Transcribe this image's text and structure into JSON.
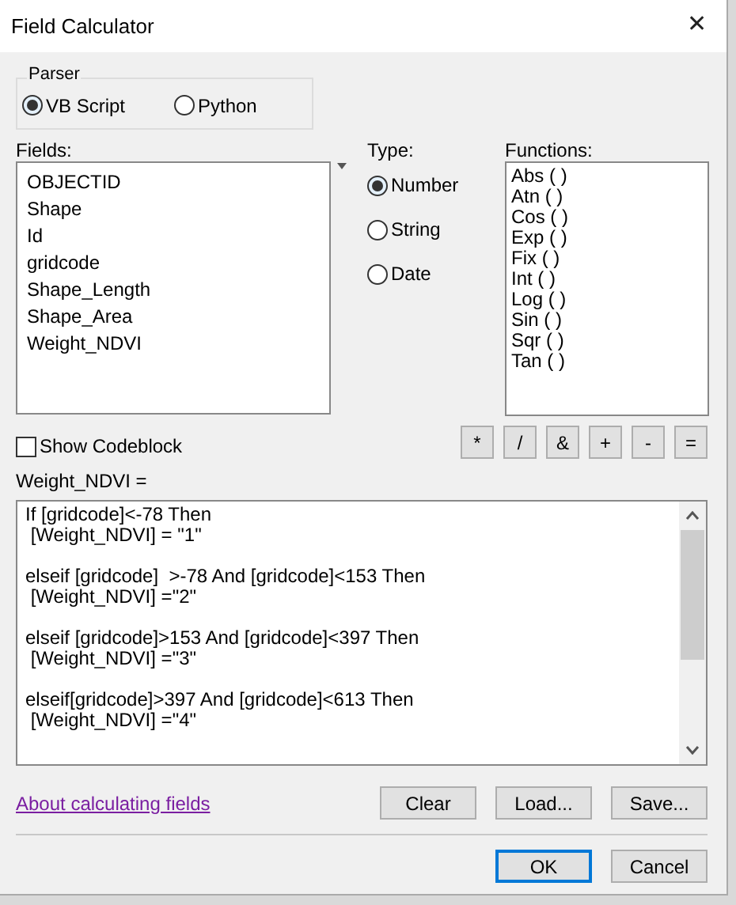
{
  "window": {
    "title": "Field Calculator",
    "close": "✕"
  },
  "parser": {
    "label": "Parser",
    "options": [
      {
        "label": "VB Script",
        "selected": true
      },
      {
        "label": "Python",
        "selected": false
      }
    ]
  },
  "fields": {
    "label": "Fields:",
    "items": [
      "OBJECTID",
      "Shape",
      "Id",
      "gridcode",
      "Shape_Length",
      "Shape_Area",
      "Weight_NDVI"
    ]
  },
  "type": {
    "label": "Type:",
    "options": [
      {
        "label": "Number",
        "selected": true
      },
      {
        "label": "String",
        "selected": false
      },
      {
        "label": "Date",
        "selected": false
      }
    ]
  },
  "functions": {
    "label": "Functions:",
    "items": [
      "Abs ( )",
      "Atn ( )",
      "Cos ( )",
      "Exp ( )",
      "Fix ( )",
      "Int ( )",
      "Log ( )",
      "Sin ( )",
      "Sqr ( )",
      "Tan ( )"
    ]
  },
  "show_codeblock": {
    "label": "Show Codeblock",
    "checked": false
  },
  "operators": [
    "*",
    "/",
    "&",
    "+",
    "-",
    "="
  ],
  "expression": {
    "label": "Weight_NDVI =",
    "blocks": [
      [
        "If [gridcode]<-78 Then",
        " [Weight_NDVI] = \"1\""
      ],
      [
        "elseif [gridcode]  >-78 And [gridcode]<153 Then",
        " [Weight_NDVI] =\"2\""
      ],
      [
        "elseif [gridcode]>153 And [gridcode]<397 Then",
        " [Weight_NDVI] =\"3\""
      ],
      [
        "elseif[gridcode]>397 And [gridcode]<613 Then",
        " [Weight_NDVI] =\"4\""
      ]
    ]
  },
  "link": "About calculating fields",
  "tool_buttons": [
    "Clear",
    "Load...",
    "Save..."
  ],
  "dialog_buttons": [
    {
      "label": "OK",
      "default": true
    },
    {
      "label": "Cancel",
      "default": false
    }
  ]
}
